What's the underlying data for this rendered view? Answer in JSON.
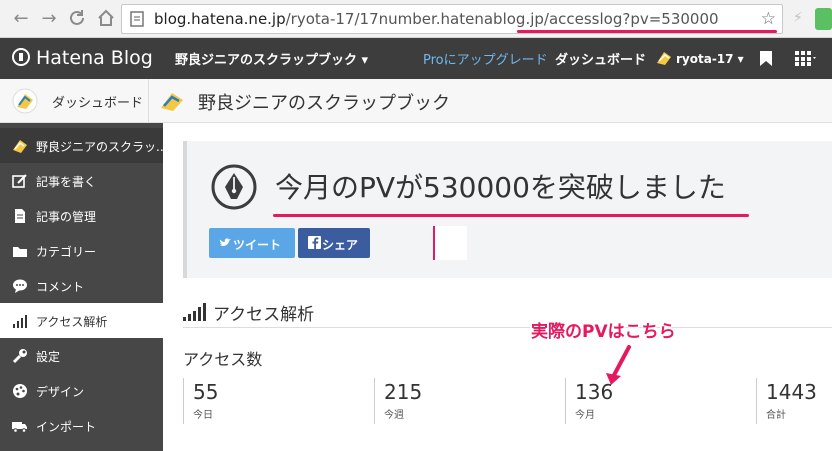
{
  "browser": {
    "url_host": "blog.hatena.ne.jp",
    "url_path": "/ryota-17/17number.hatenablog.jp/accesslog?pv=530000"
  },
  "header": {
    "logo": "Hatena Blog",
    "blog_menu": "野良ジニアのスクラップブック",
    "upgrade": "Proにアップグレード",
    "dashboard": "ダッシュボード",
    "user": "ryota-17"
  },
  "dashbar": {
    "dashboard": "ダッシュボード",
    "blog_title": "野良ジニアのスクラップブック"
  },
  "sidebar": {
    "items": [
      {
        "label": "野良ジニアのスクラッ...",
        "icon": "blog-avatar-icon"
      },
      {
        "label": "記事を書く",
        "icon": "edit-icon"
      },
      {
        "label": "記事の管理",
        "icon": "document-icon"
      },
      {
        "label": "カテゴリー",
        "icon": "folder-icon"
      },
      {
        "label": "コメント",
        "icon": "comment-icon"
      },
      {
        "label": "アクセス解析",
        "icon": "bar-chart-icon"
      },
      {
        "label": "設定",
        "icon": "wrench-icon"
      },
      {
        "label": "デザイン",
        "icon": "palette-icon"
      },
      {
        "label": "インポート",
        "icon": "truck-icon"
      }
    ]
  },
  "banner": {
    "title": "今月のPVが530000を突破しました",
    "tweet": "ツイート",
    "share": "シェア"
  },
  "access": {
    "section_title": "アクセス解析",
    "label": "アクセス数",
    "callout": "実際のPVはこちら",
    "stats": [
      {
        "value": "55",
        "caption": "今日"
      },
      {
        "value": "215",
        "caption": "今週"
      },
      {
        "value": "136",
        "caption": "今月"
      },
      {
        "value": "1443",
        "caption": "合計"
      }
    ]
  },
  "colors": {
    "accent": "#e5195f",
    "header_bg": "#3d3d3d",
    "sidebar_bg": "#474747",
    "twitter": "#5aa6e6",
    "facebook": "#3b5c9f"
  }
}
